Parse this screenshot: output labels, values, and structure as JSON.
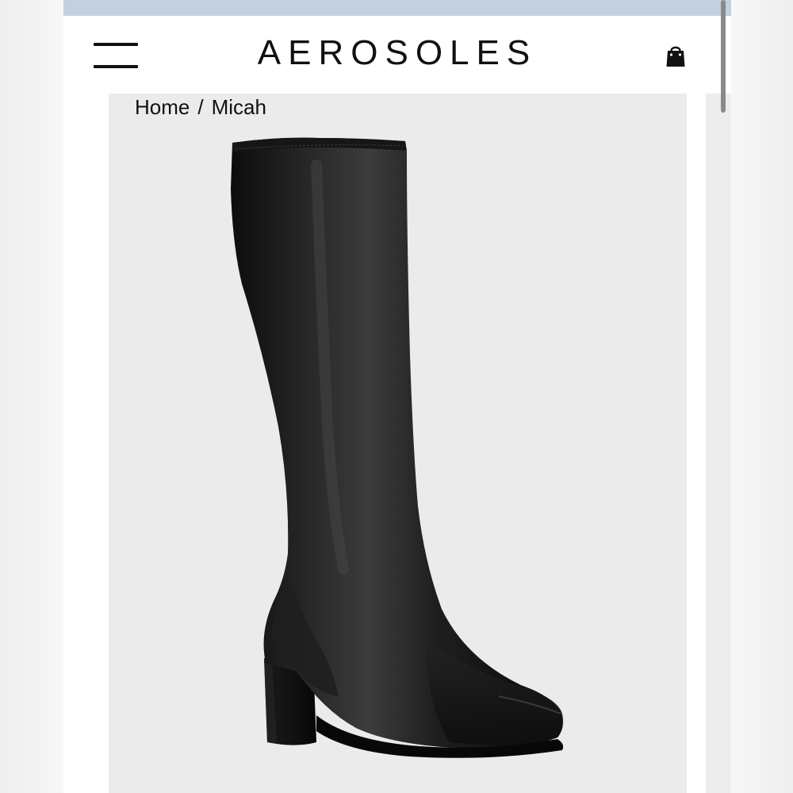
{
  "header": {
    "logo": "AEROSOLES",
    "menu_icon": "hamburger-menu-icon",
    "cart_icon": "shopping-bag-icon"
  },
  "breadcrumb": {
    "home": "Home",
    "separator": "/",
    "current": "Micah"
  },
  "product": {
    "image_icon": "knee-high-boot-image"
  },
  "colors": {
    "promo_bar": "#c3d0de",
    "media_background": "#ebebeb",
    "text": "#111111"
  }
}
